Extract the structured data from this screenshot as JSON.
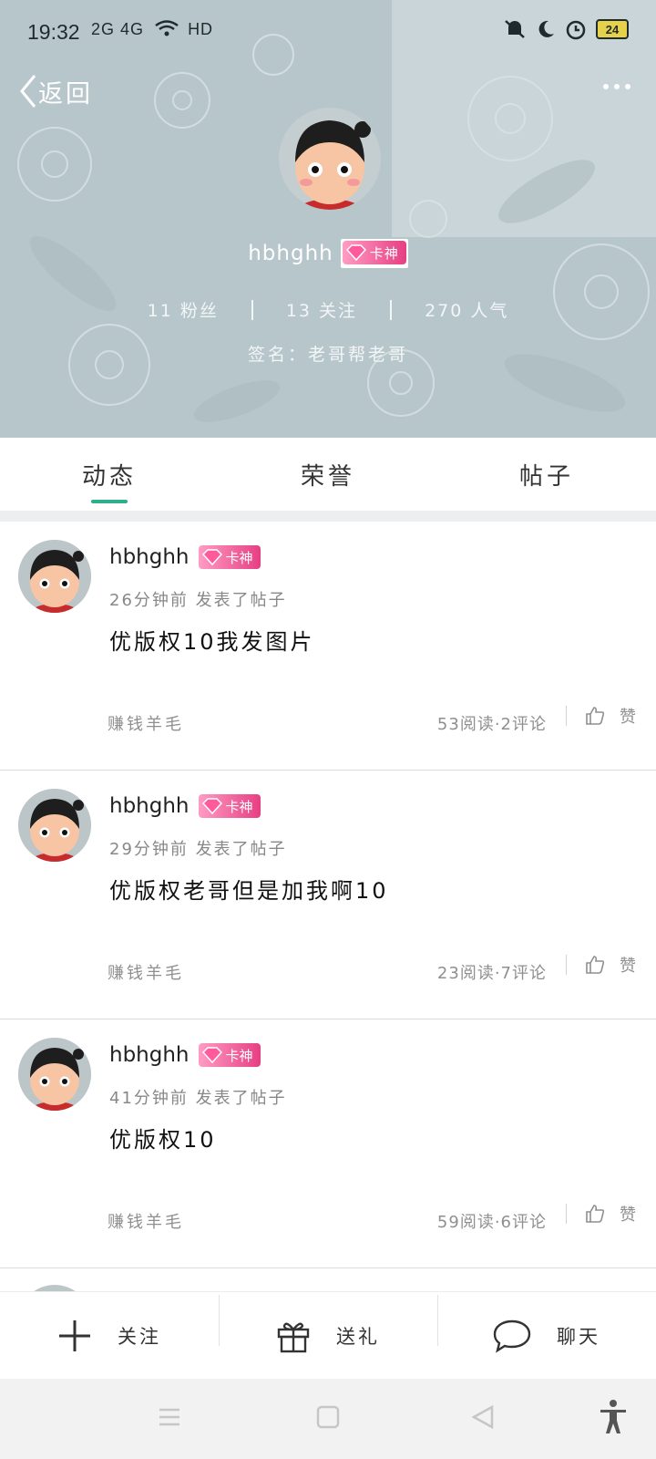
{
  "status_bar": {
    "time": "19:32",
    "network": "2G 4G",
    "hd_label": "HD",
    "battery": "24"
  },
  "header": {
    "back_label": "返回",
    "username": "hbhghh",
    "badge_label": "卡神",
    "stats": {
      "fans": "11 粉丝",
      "following": "13 关注",
      "popularity": "270 人气"
    },
    "signature": "签名：老哥帮老哥"
  },
  "tabs": [
    {
      "label": "动态"
    },
    {
      "label": "荣誉"
    },
    {
      "label": "帖子"
    }
  ],
  "posts": [
    {
      "username": "hbhghh",
      "badge": "卡神",
      "meta": "26分钟前  发表了帖子",
      "title": "优版权10我发图片",
      "tag": "赚钱羊毛",
      "stats": "53阅读·2评论",
      "like_label": "赞"
    },
    {
      "username": "hbhghh",
      "badge": "卡神",
      "meta": "29分钟前  发表了帖子",
      "title": "优版权老哥但是加我啊10",
      "tag": "赚钱羊毛",
      "stats": "23阅读·7评论",
      "like_label": "赞"
    },
    {
      "username": "hbhghh",
      "badge": "卡神",
      "meta": "41分钟前  发表了帖子",
      "title": "优版权10",
      "tag": "赚钱羊毛",
      "stats": "59阅读·6评论",
      "like_label": "赞"
    }
  ],
  "actions": {
    "follow": "关注",
    "gift": "送礼",
    "chat": "聊天"
  },
  "colors": {
    "accent": "#2fae8c",
    "badge": "#e63f83",
    "banner": "#b9c8cc"
  }
}
